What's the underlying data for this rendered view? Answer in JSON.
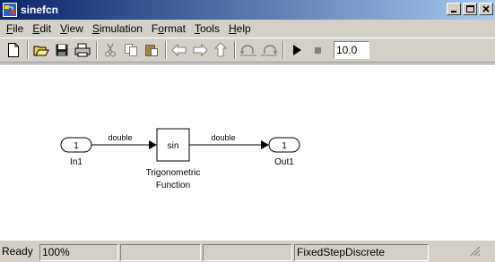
{
  "window": {
    "title": "sinefcn",
    "icons": {
      "app": "simulink-model-icon",
      "minimize": "minimize-icon",
      "maximize": "maximize-icon",
      "close": "close-icon"
    }
  },
  "menubar": {
    "items": [
      {
        "label": "File",
        "accel": "F",
        "rest": "ile"
      },
      {
        "label": "Edit",
        "accel": "E",
        "rest": "dit"
      },
      {
        "label": "View",
        "accel": "V",
        "rest": "iew"
      },
      {
        "label": "Simulation",
        "accel": "S",
        "rest": "imulation"
      },
      {
        "label": "Format",
        "pre": "F",
        "accel": "o",
        "rest": "rmat"
      },
      {
        "label": "Tools",
        "accel": "T",
        "rest": "ools"
      },
      {
        "label": "Help",
        "accel": "H",
        "rest": "elp"
      }
    ]
  },
  "toolbar": {
    "buttons": [
      "new-icon",
      "open-icon",
      "save-icon",
      "print-icon",
      "cut-icon",
      "copy-icon",
      "paste-icon",
      "back-icon",
      "forward-icon",
      "up-icon",
      "undo-icon",
      "redo-icon",
      "start-icon",
      "stop-icon"
    ],
    "stop_time": "10.0"
  },
  "diagram": {
    "inport": {
      "number": "1",
      "name": "In1"
    },
    "sin_block": {
      "label": "sin",
      "name_line1": "Trigonometric",
      "name_line2": "Function"
    },
    "outport": {
      "number": "1",
      "name": "Out1"
    },
    "signal_in": "double",
    "signal_out": "double"
  },
  "statusbar": {
    "status": "Ready",
    "zoom": "100%",
    "solver": "FixedStepDiscrete"
  }
}
